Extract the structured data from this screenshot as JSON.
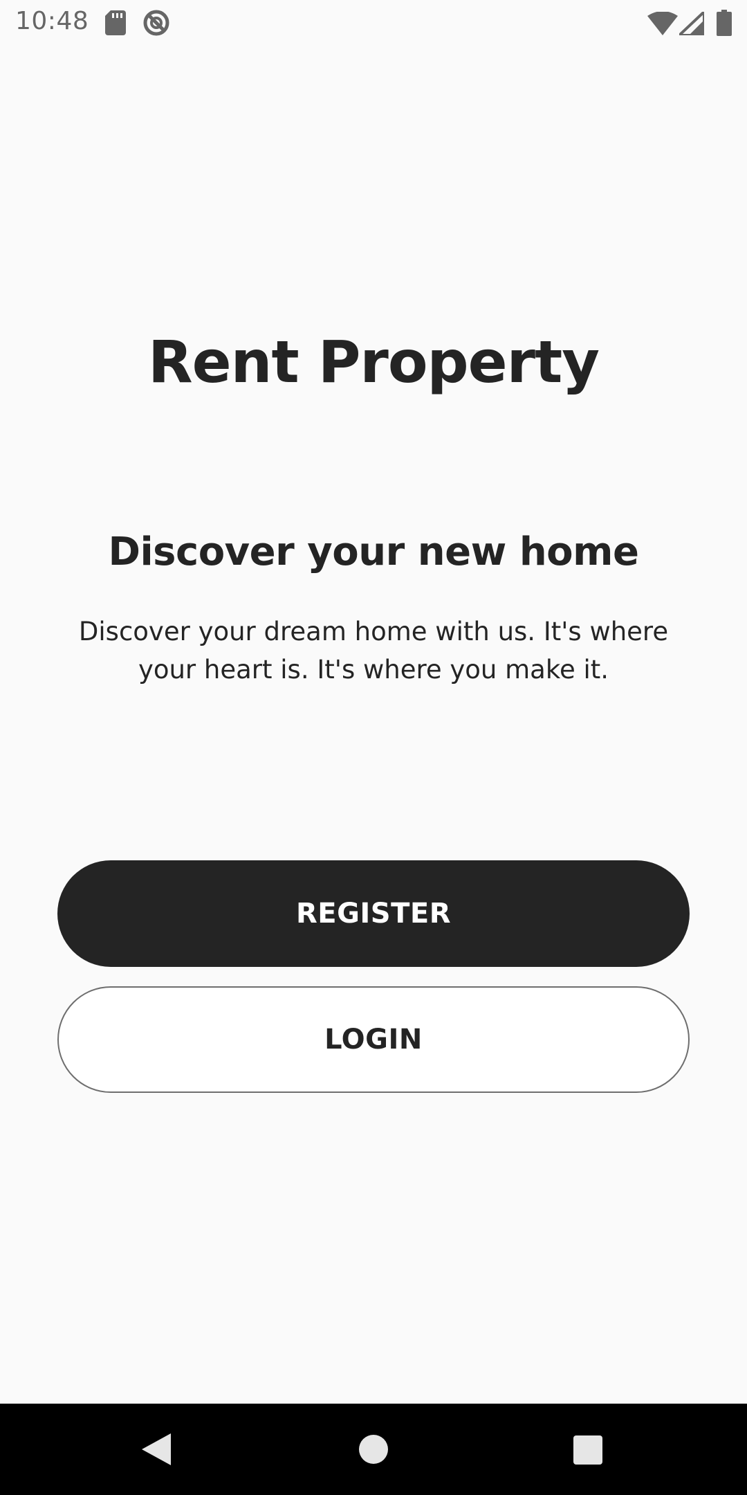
{
  "status_bar": {
    "time": "10:48",
    "icons": [
      "sd-card-icon",
      "sync-disabled-icon",
      "wifi-icon",
      "cell-signal-icon",
      "battery-icon"
    ]
  },
  "main": {
    "app_title": "Rent Property",
    "headline": "Discover your new home",
    "description": "Discover your dream home with us. It's where your heart is. It's where you make it."
  },
  "actions": {
    "register_label": "REGISTER",
    "login_label": "LOGIN"
  },
  "nav_bar": {
    "icons": [
      "back-icon",
      "home-icon",
      "recents-icon"
    ]
  },
  "colors": {
    "background": "#fafafa",
    "primary": "#242424",
    "on_primary": "#ffffff",
    "outline": "#6e6e6e",
    "nav_bar": "#000000"
  }
}
